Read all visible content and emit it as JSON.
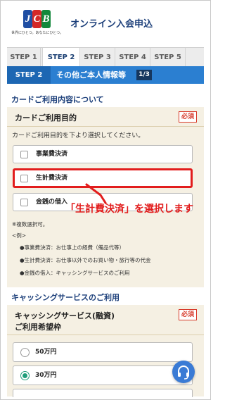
{
  "header": {
    "logo_text": "JCB",
    "logo_tagline": "世界にひとつ。あなたにひとつ。",
    "title": "オンライン入会申込"
  },
  "steps": [
    {
      "label": "STEP 1"
    },
    {
      "label": "STEP 2"
    },
    {
      "label": "STEP 3"
    },
    {
      "label": "STEP 4"
    },
    {
      "label": "STEP 5"
    }
  ],
  "subheader": {
    "step": "STEP 2",
    "title": "その他ご本人情報等",
    "page": "1/3"
  },
  "section1": {
    "heading": "カードご利用内容について",
    "panel_title": "カードご利用目的",
    "required": "必須",
    "instruction": "カードご利用目的を下より選択してください。",
    "options": [
      {
        "label": "事業費決済"
      },
      {
        "label": "生計費決済"
      },
      {
        "label": "金銭の借入"
      }
    ],
    "notes": [
      "※複数選択可。",
      "<例>",
      "●事業費決済：お仕事上の経費（備品代等）",
      "●生計費決済：お仕事以外でのお買い物・旅行等の代金",
      "●金銭の借入：キャッシングサービスのご利用"
    ]
  },
  "callout": {
    "text": "「生計費決済」を選択します",
    "color": "#e21d1d"
  },
  "section2": {
    "heading": "キャッシングサービスのご利用",
    "panel_title_line1": "キャッシングサービス(融資)",
    "panel_title_line2": "ご利用希望枠",
    "required": "必須",
    "options": [
      {
        "label": "50万円",
        "selected": false
      },
      {
        "label": "30万円",
        "selected": true
      }
    ]
  },
  "colors": {
    "brand_blue": "#1c3f7a",
    "step_bar": "#2b7fd1",
    "panel_bg": "#f5f0e3",
    "required": "#d73a2a",
    "radio_selected": "#1f9e7a"
  },
  "icons": {
    "fab": "headset-icon"
  }
}
